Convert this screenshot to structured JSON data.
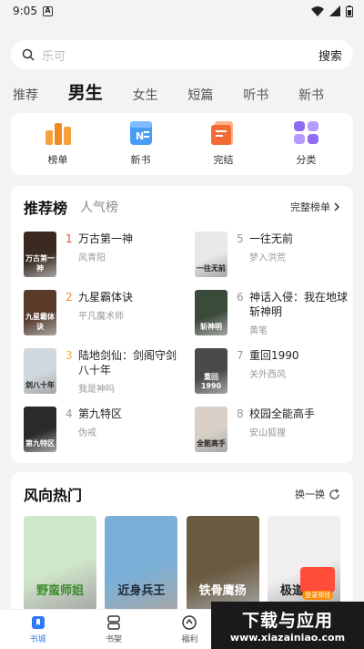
{
  "status": {
    "time": "9:05"
  },
  "search": {
    "placeholder": "乐可",
    "button": "搜索"
  },
  "tabs": [
    "推荐",
    "男生",
    "女生",
    "短篇",
    "听书",
    "新书"
  ],
  "quick": [
    "榜单",
    "新书",
    "完结",
    "分类"
  ],
  "rank": {
    "title": "推荐榜",
    "alt": "人气榜",
    "more": "完整榜单",
    "books": [
      {
        "num": "1",
        "title": "万古第一神",
        "author": "风青阳",
        "cover": "#3a2a20",
        "label": "万古第一神"
      },
      {
        "num": "5",
        "title": "一往无前",
        "author": "梦入洪荒",
        "cover": "#e8e8e8",
        "label": "一往无前"
      },
      {
        "num": "2",
        "title": "九星霸体诀",
        "author": "平凡魔术师",
        "cover": "#5a3b2a",
        "label": "九星霸体诀"
      },
      {
        "num": "6",
        "title": "神话入侵：我在地球斩神明",
        "author": "黄笔",
        "cover": "#3b4b3b",
        "label": "斩神明"
      },
      {
        "num": "3",
        "title": "陆地剑仙：剑阁守剑八十年",
        "author": "我是神吗",
        "cover": "#cfd8dc",
        "label": "剑八十年"
      },
      {
        "num": "7",
        "title": "重回1990",
        "author": "关外西风",
        "cover": "#4a4a4a",
        "label": "重回1990"
      },
      {
        "num": "4",
        "title": "第九特区",
        "author": "伪戒",
        "cover": "#2a2a2a",
        "label": "第九特区"
      },
      {
        "num": "8",
        "title": "校园全能高手",
        "author": "安山狐狸",
        "cover": "#d8d0c8",
        "label": "全能高手"
      }
    ]
  },
  "trend": {
    "title": "风向热门",
    "more": "换一换",
    "books": [
      {
        "cover": "#cfe6c8",
        "label": "野蛮师姐"
      },
      {
        "cover": "#7ab0d8",
        "label": "近身兵王"
      },
      {
        "cover": "#6a5a40",
        "label": "铁骨鹰扬"
      },
      {
        "cover": "#f0eeee",
        "label": "极道天骄"
      }
    ],
    "redpack": "登录领钱"
  },
  "nav": [
    "书城",
    "书架",
    "福利"
  ],
  "watermark": {
    "line1": "下载与应用",
    "line2": "www.xiazainiao.com"
  },
  "colors": {
    "accent": "#2f7bf5",
    "rank1": "#e74c3c",
    "rank2": "#f08a3c",
    "rank3": "#f2b23c"
  }
}
